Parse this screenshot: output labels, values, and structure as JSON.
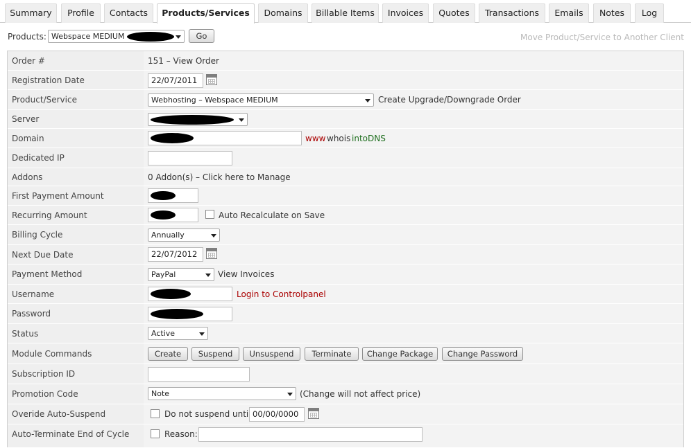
{
  "tabs": [
    "Summary",
    "Profile",
    "Contacts",
    "Products/Services",
    "Domains",
    "Billable Items",
    "Invoices",
    "Quotes",
    "Transactions",
    "Emails",
    "Notes",
    "Log"
  ],
  "topbar": {
    "products_label": "Products:",
    "products_value": "Webspace MEDIUM –",
    "go_label": "Go",
    "move_link": "Move Product/Service to Another Client"
  },
  "form": {
    "order_label": "Order #",
    "order_value": "151 – View Order",
    "registration_label": "Registration Date",
    "registration_value": "22/07/2011",
    "product_label": "Product/Service",
    "product_value": "Webhosting – Webspace MEDIUM",
    "upgrade_link": "Create Upgrade/Downgrade Order",
    "server_label": "Server",
    "domain_label": "Domain",
    "domain_links": {
      "www": "www",
      "whois": "whois",
      "intodns": "intoDNS"
    },
    "dedicated_ip_label": "Dedicated IP",
    "addons_label": "Addons",
    "addons_value": "0 Addon(s) – Click here to Manage",
    "first_payment_label": "First Payment Amount",
    "recurring_label": "Recurring Amount",
    "auto_recalc_label": "Auto Recalculate on Save",
    "billing_cycle_label": "Billing Cycle",
    "billing_cycle_value": "Annually",
    "next_due_label": "Next Due Date",
    "next_due_value": "22/07/2012",
    "payment_method_label": "Payment Method",
    "payment_method_value": "PayPal",
    "view_invoices_link": "View Invoices",
    "username_label": "Username",
    "login_link": "Login to Controlpanel",
    "password_label": "Password",
    "status_label": "Status",
    "status_value": "Active",
    "module_commands_label": "Module Commands",
    "module_buttons": [
      "Create",
      "Suspend",
      "Unsuspend",
      "Terminate",
      "Change Package",
      "Change Password"
    ],
    "subscription_label": "Subscription ID",
    "promotion_label": "Promotion Code",
    "promotion_value": "Note",
    "promotion_note": "(Change will not affect price)",
    "override_label": "Overide Auto-Suspend",
    "do_not_suspend_label": "Do not suspend until",
    "suspend_date_value": "00/00/0000",
    "auto_terminate_label": "Auto-Terminate End of Cycle",
    "reason_label": "Reason:"
  }
}
